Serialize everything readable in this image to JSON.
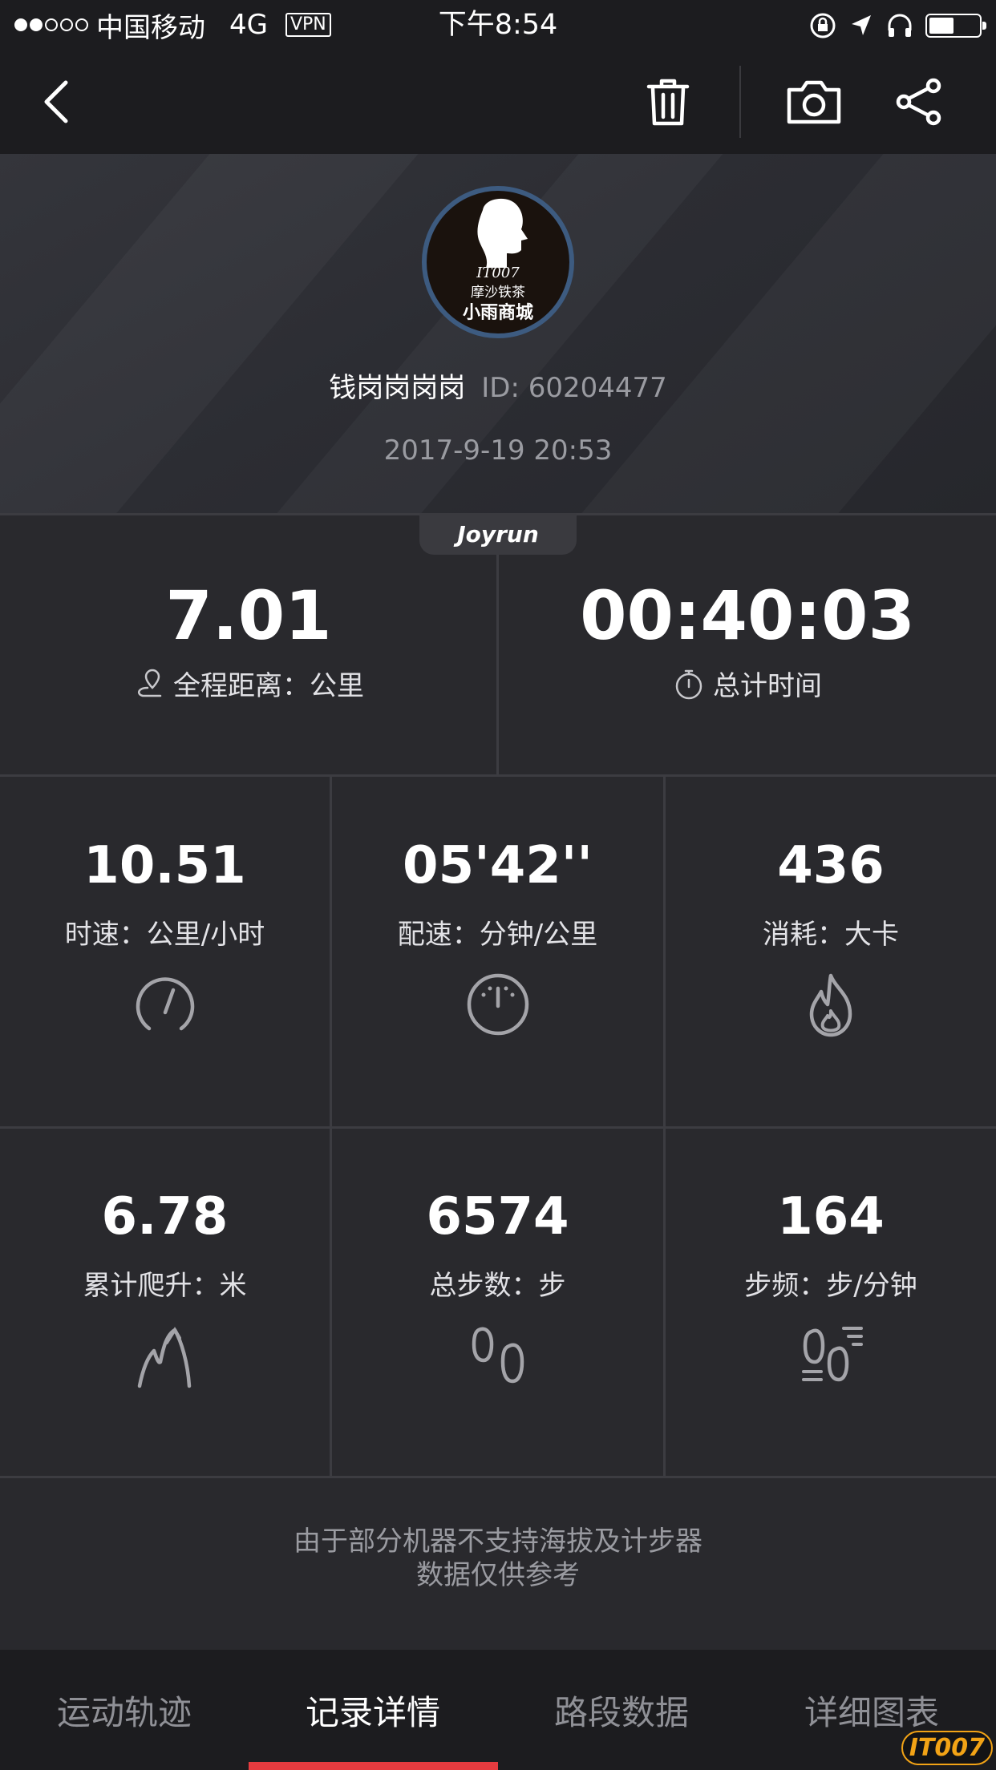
{
  "status_bar": {
    "carrier": "中国移动",
    "network": "4G",
    "vpn": "VPN",
    "time": "下午8:54"
  },
  "nav": {
    "icons": [
      "back-icon",
      "trash-icon",
      "camera-icon",
      "share-icon"
    ]
  },
  "profile": {
    "avatar_lines": [
      "IT007",
      "摩沙铁茶",
      "小雨商城"
    ],
    "name": "钱岗岗岗岗",
    "id_text": "ID: 60204477",
    "date": "2017-9-19 20:53"
  },
  "brand": "Joyrun",
  "summary": {
    "distance": {
      "value": "7.01",
      "label": "全程距离：公里"
    },
    "duration": {
      "value": "00:40:03",
      "label": "总计时间"
    }
  },
  "metrics": [
    {
      "value": "10.51",
      "label": "时速：公里/小时",
      "icon": "speedometer-icon"
    },
    {
      "value": "05'42''",
      "label": "配速：分钟/公里",
      "icon": "pace-gauge-icon"
    },
    {
      "value": "436",
      "label": "消耗：大卡",
      "icon": "flame-icon"
    },
    {
      "value": "6.78",
      "label": "累计爬升：米",
      "icon": "climb-icon"
    },
    {
      "value": "6574",
      "label": "总步数：步",
      "icon": "footprints-icon"
    },
    {
      "value": "164",
      "label": "步频：步/分钟",
      "icon": "cadence-icon"
    }
  ],
  "note": {
    "line1": "由于部分机器不支持海拔及计步器",
    "line2": "数据仅供参考"
  },
  "tabs": [
    {
      "label": "运动轨迹"
    },
    {
      "label": "记录详情",
      "active": true
    },
    {
      "label": "路段数据"
    },
    {
      "label": "详细图表"
    }
  ],
  "watermark": "IT007",
  "colors": {
    "accent": "#e63b3f",
    "background": "#29292d",
    "bar": "#1c1c1f"
  }
}
